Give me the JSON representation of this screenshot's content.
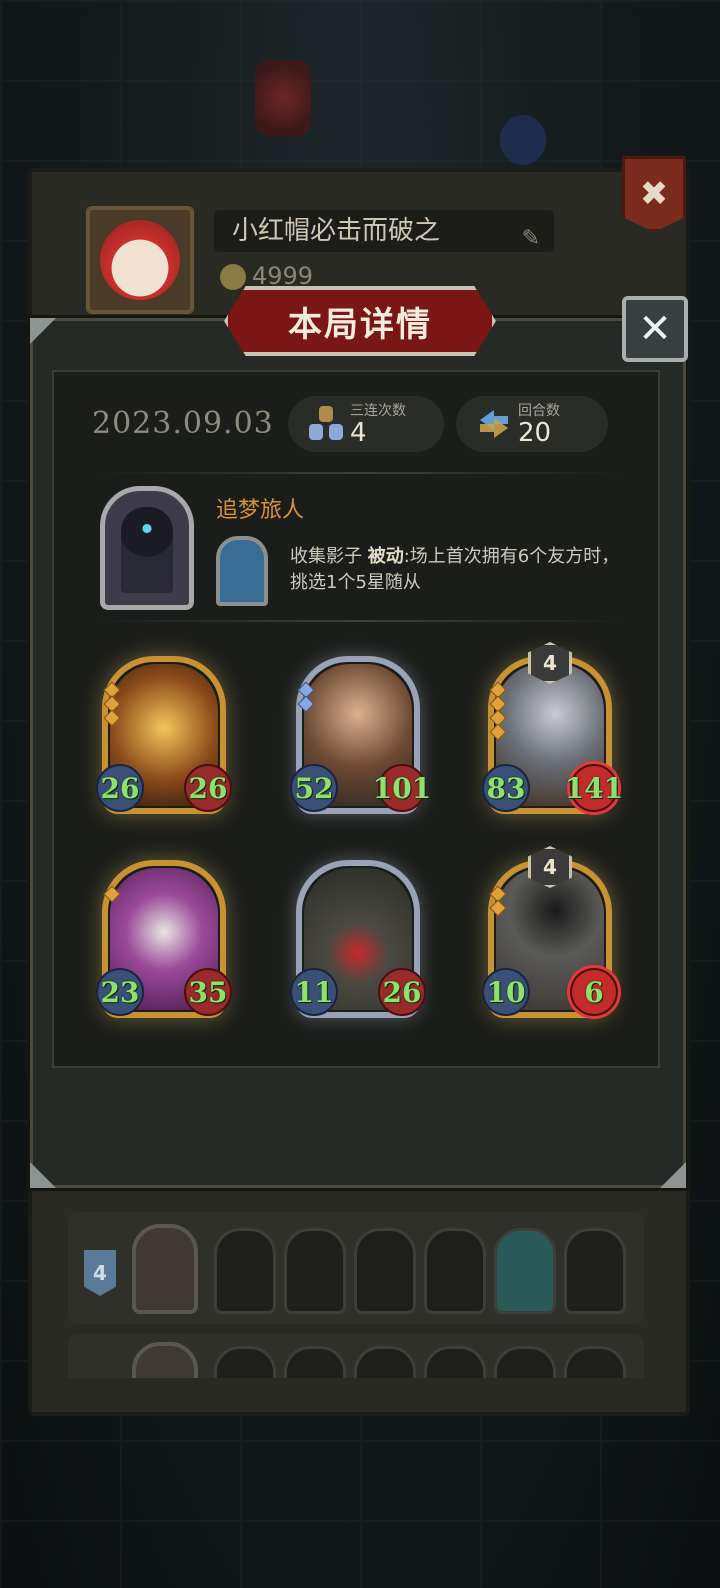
{
  "profile": {
    "player_name": "小红帽必击而破之",
    "coins": "4999",
    "close_label": "✖",
    "edit_icon": "pencil-icon"
  },
  "modal": {
    "title": "本局详情",
    "close_label": "✕",
    "date": "2023.09.03",
    "stats": {
      "triple_label": "三连次数",
      "triple_value": "4",
      "rounds_label": "回合数",
      "rounds_value": "20"
    },
    "hero": {
      "name": "追梦旅人",
      "skill_name": "收集影子",
      "skill_type": "被动",
      "skill_desc": ":场上首次拥有6个友方时，挑选1个5星随从"
    },
    "units": [
      {
        "atk": "26",
        "hp": "26",
        "tier": "gold",
        "level": "",
        "hp_buffed": false
      },
      {
        "atk": "52",
        "hp": "101",
        "tier": "silver",
        "level": "",
        "hp_buffed": false
      },
      {
        "atk": "83",
        "hp": "141",
        "tier": "gold",
        "level": "4",
        "hp_buffed": true
      },
      {
        "atk": "23",
        "hp": "35",
        "tier": "gold",
        "level": "",
        "hp_buffed": false
      },
      {
        "atk": "11",
        "hp": "26",
        "tier": "silver",
        "level": "",
        "hp_buffed": false
      },
      {
        "atk": "10",
        "hp": "6",
        "tier": "gold",
        "level": "4",
        "hp_buffed": true
      }
    ]
  },
  "lineup": {
    "rank": "4"
  },
  "colors": {
    "gold_frame": "#c89233",
    "silver_frame": "#9aa2b5",
    "stat_green": "#8fe06c",
    "title_red": "#7a1616",
    "hero_name": "#d7923a"
  }
}
